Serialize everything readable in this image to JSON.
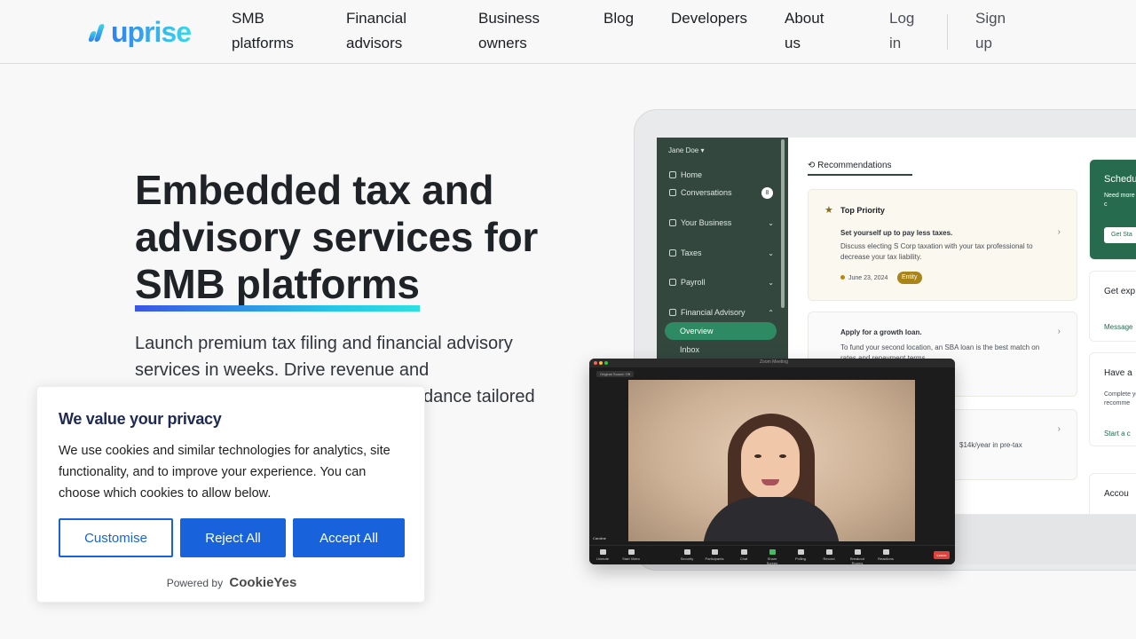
{
  "nav": {
    "logo": "uprise",
    "items": [
      {
        "id": "smb",
        "line1": "SMB",
        "line2": "platforms"
      },
      {
        "id": "financial",
        "line1": "Financial",
        "line2": "advisors"
      },
      {
        "id": "business",
        "line1": "Business",
        "line2": "owners"
      },
      {
        "id": "blog",
        "line1": "Blog",
        "line2": ""
      },
      {
        "id": "developers",
        "line1": "Developers",
        "line2": ""
      },
      {
        "id": "about",
        "line1": "About",
        "line2": "us"
      }
    ],
    "login": {
      "line1": "Log",
      "line2": "in"
    },
    "signup": {
      "line1": "Sign",
      "line2": "up"
    }
  },
  "hero": {
    "title_line1": "Embedded tax and",
    "title_line2": "advisory services for",
    "title_highlight": "SMB platforms",
    "subtitle_line1": "Launch premium tax filing and financial advisory",
    "subtitle_line2": "services in weeks. Drive revenue and",
    "subtitle_line3_visible": "dance tailored"
  },
  "app_mock": {
    "user": "Jane Doe",
    "sidebar": {
      "home": "Home",
      "conversations": "Conversations",
      "conversations_count": "8",
      "your_business": "Your Business",
      "taxes": "Taxes",
      "payroll": "Payroll",
      "financial_advisory": "Financial Advisory",
      "overview": "Overview",
      "inbox": "Inbox"
    },
    "tab": "Recommendations",
    "card1": {
      "priority": "Top Priority",
      "heading": "Set yourself up to pay less taxes.",
      "desc": "Discuss electing S Corp taxation with your tax professional to decrease your tax liability.",
      "date": "June 23, 2024",
      "tag": "Entity"
    },
    "card2": {
      "heading": "Apply for a growth loan.",
      "desc": "To fund your second location, an SBA loan is the best match on rates and repayment terms."
    },
    "card3": {
      "desc": "$14k/year in pre-tax"
    },
    "right": {
      "schedule_title": "Schedu",
      "schedule_desc": "Need more with your c",
      "schedule_btn": "Get Sta",
      "expert_title": "Get exp anytim",
      "expert_link": "Message",
      "have_title": "Have a",
      "have_desc": "Complete your finan recomme",
      "have_link": "Start a c",
      "account_title": "Accou"
    }
  },
  "video": {
    "title": "Zoom Meeting",
    "tag": "Original Sound: Off",
    "participant": "Caroline",
    "controls": [
      "Unmute",
      "Start Video",
      "Security",
      "Participants",
      "Chat",
      "Share Screen",
      "Polling",
      "Record",
      "Breakout Rooms",
      "Reactions"
    ],
    "leave": "Leave"
  },
  "cookie": {
    "title": "We value your privacy",
    "body": "We use cookies and similar technologies for analytics, site functionality, and to improve your experience. You can choose which cookies to allow below.",
    "customise": "Customise",
    "reject": "Reject All",
    "accept": "Accept All",
    "powered_by": "Powered by",
    "brand": "CookieYes"
  },
  "colors": {
    "accent_blue": "#1863dc",
    "sidebar_green": "#33473f",
    "brand_gradient_start": "#2f80f0",
    "brand_gradient_end": "#3ad8e8"
  }
}
